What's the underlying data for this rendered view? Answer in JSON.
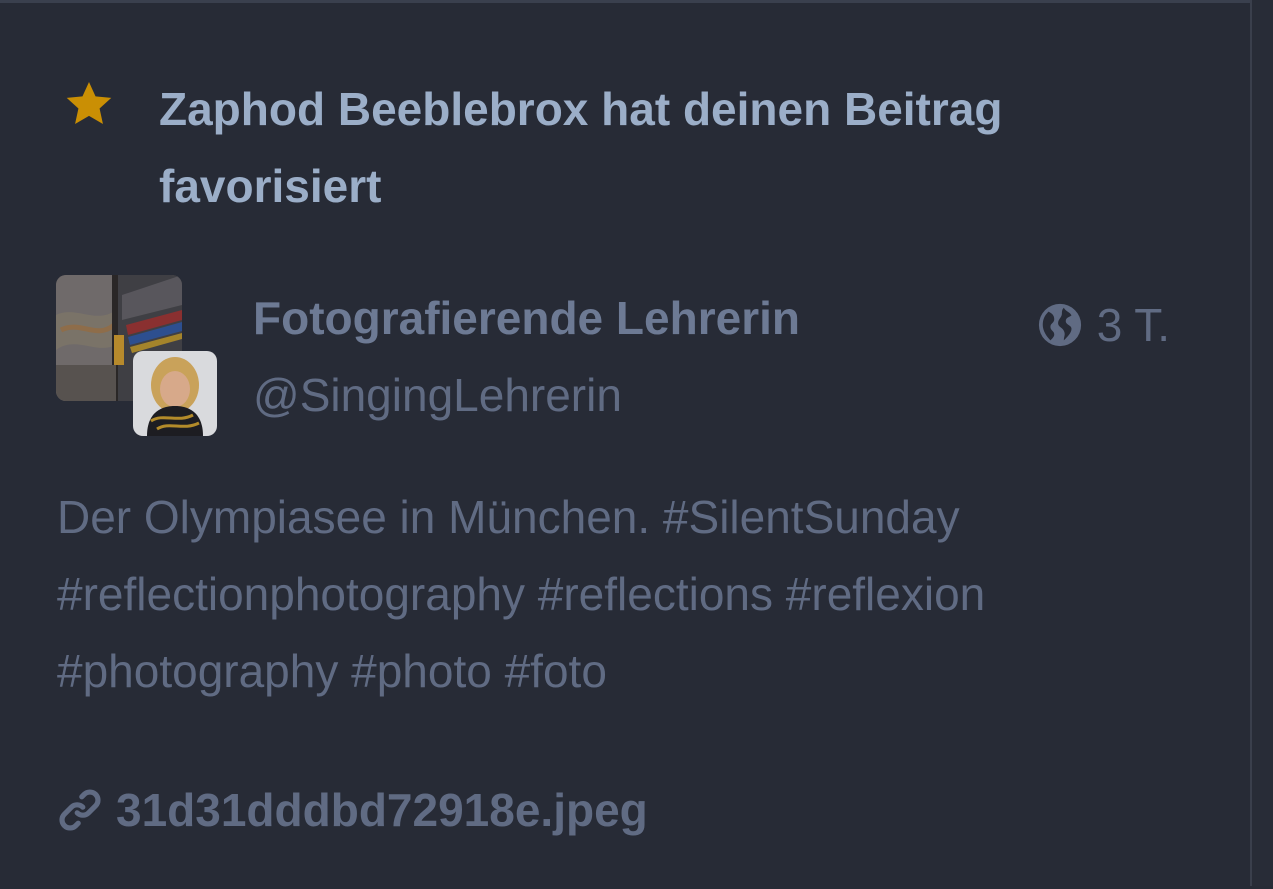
{
  "notification": {
    "icon": "star-icon",
    "icon_color": "#ca8f04",
    "text": "Zaphod Beeblebrox hat deinen Beitrag favorisiert"
  },
  "status": {
    "author": {
      "display_name": "Fotografierende Lehrerin",
      "handle": "@SingingLehrerin"
    },
    "visibility_icon": "globe-icon",
    "relative_time": "3 T.",
    "content": "Der Olympiasee in München. #SilentSunday #reflectionphotography #reflections #reflexion #photography #photo #foto",
    "attachment": {
      "icon": "link-icon",
      "filename": "31d31dddbd72918e.jpeg"
    }
  },
  "colors": {
    "background": "#272b36",
    "primary_text": "#9baec8",
    "dim_text": "#606b83",
    "star": "#ca8f04"
  }
}
